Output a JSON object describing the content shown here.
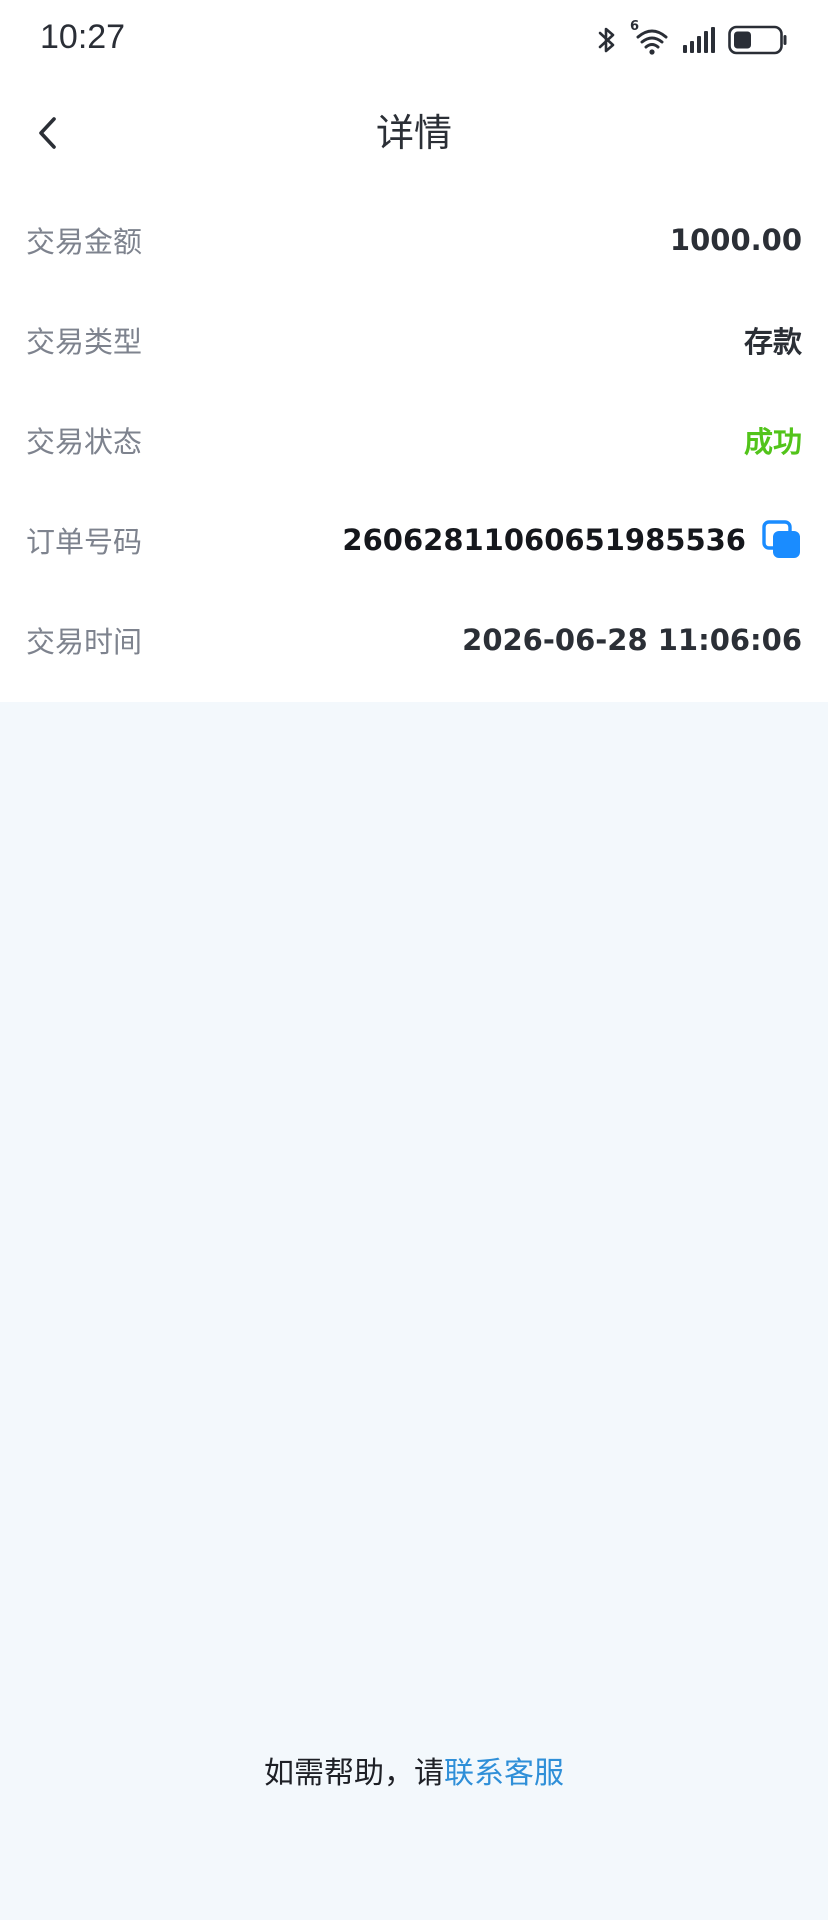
{
  "status_bar": {
    "time": "10:27",
    "network_label": "6",
    "icons": [
      "bluetooth-icon",
      "wifi-icon",
      "signal-icon",
      "battery-icon"
    ]
  },
  "header": {
    "title": "详情",
    "back_icon": "chevron-left-icon"
  },
  "details": [
    {
      "key": "amount",
      "label": "交易金额",
      "value": "1000.00",
      "color": "#2b2f36"
    },
    {
      "key": "type",
      "label": "交易类型",
      "value": "存款",
      "color": "#2b2f36"
    },
    {
      "key": "status",
      "label": "交易状态",
      "value": "成功",
      "color": "#52c41a"
    },
    {
      "key": "order",
      "label": "订单号码",
      "value": "2606281106065198553​6",
      "color": "#15171c"
    },
    {
      "key": "time",
      "label": "交易时间",
      "value": "2026-06-28 11:06:06",
      "color": "#2b2f36"
    }
  ],
  "footer": {
    "help_prefix": "如需帮助，请",
    "help_link": "联系客服"
  },
  "colors": {
    "accent": "#2f8fd8",
    "copy_icon": "#1a8cff",
    "success": "#52c41a",
    "background": "#f3f8fc"
  }
}
